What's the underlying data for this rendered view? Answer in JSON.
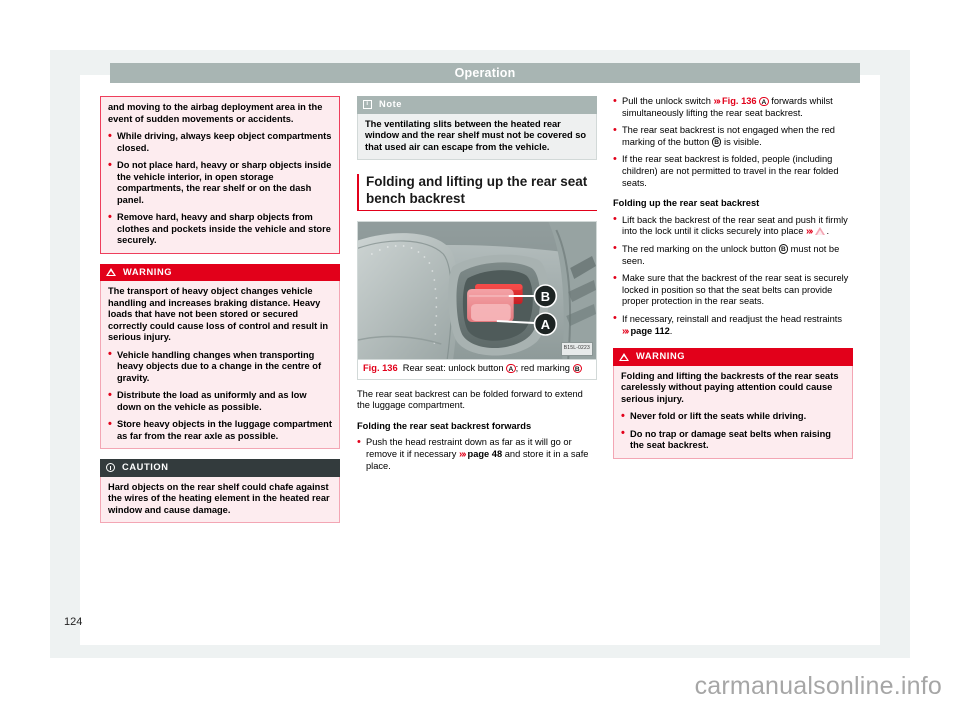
{
  "header": {
    "title": "Operation"
  },
  "footer": {
    "page_number": "124",
    "watermark": "carmanualsonline.info"
  },
  "column1": {
    "box_warning_continued": {
      "intro": "and moving to the airbag deployment area in the event of sudden movements or accidents.",
      "bullets": [
        "While driving, always keep object compartments closed.",
        "Do not place hard, heavy or sharp objects inside the vehicle interior, in open storage compartments, the rear shelf or on the dash panel.",
        "Remove hard, heavy and sharp objects from clothes and pockets inside the vehicle and store securely."
      ]
    },
    "box_warning": {
      "title": "WARNING",
      "icon": "warning-triangle-icon",
      "intro": "The transport of heavy object changes vehicle handling and increases braking distance. Heavy loads that have not been stored or secured correctly could cause loss of control and result in serious injury.",
      "bullets": [
        "Vehicle handling changes when transporting heavy objects due to a change in the centre of gravity.",
        "Distribute the load as uniformly and as low down on the vehicle as possible.",
        "Store heavy objects in the luggage compartment as far from the rear axle as possible."
      ]
    },
    "box_caution": {
      "title": "CAUTION",
      "icon": "exclamation-circle-icon",
      "text": "Hard objects on the rear shelf could chafe against the wires of the heating element in the heated rear window and cause damage."
    }
  },
  "column2": {
    "box_note": {
      "title": "Note",
      "icon": "info-icon",
      "text": "The ventilating slits between the heated rear window and the rear shelf must not be covered so that used air can escape from the vehicle."
    },
    "section_heading": "Folding and lifting up the rear seat bench backrest",
    "figure": {
      "number": "Fig. 136",
      "caption_part1": "Rear seat: unlock button ",
      "marker_a": "A",
      "caption_part2": "; red marking ",
      "marker_b": "B",
      "image_code": "B15L-0223",
      "callout_a": "A",
      "callout_b": "B"
    },
    "intro": "The rear seat backrest can be folded forward to extend the luggage compartment.",
    "sub_heading": "Folding the rear seat backrest forwards",
    "bullet1_part1": "Push the head restraint down as far as it will go or remove it if necessary ",
    "bullet1_ref": "page 48",
    "bullet1_part2": " and store it in a safe place."
  },
  "column3": {
    "bullet1_part1": "Pull the unlock switch ",
    "bullet1_ref": "Fig. 136",
    "bullet1_marker": "A",
    "bullet1_part2": " forwards whilst simultaneously lifting the rear seat backrest.",
    "bullet2_part1": "The rear seat backrest is not engaged when the red marking of the button ",
    "bullet2_marker": "B",
    "bullet2_part2": " is visible.",
    "bullet3": "If the rear seat backrest is folded, people (including children) are not permitted to travel in the rear folded seats.",
    "sub_heading": "Folding up the rear seat backrest",
    "bullet4_part1": "Lift back the backrest of the rear seat and push it firmly into the lock until it clicks securely into place ",
    "bullet4_part2": ".",
    "bullet5_part1": "The red marking on the unlock button ",
    "bullet5_marker": "B",
    "bullet5_part2": " must not be seen.",
    "bullet6": "Make sure that the backrest of the rear seat is securely locked in position so that the seat belts can provide proper protection in the rear seats.",
    "bullet7_part1": "If necessary, reinstall and readjust the head restraints ",
    "bullet7_ref": "page 112",
    "bullet7_part2": ".",
    "box_warning": {
      "title": "WARNING",
      "icon": "warning-triangle-icon",
      "intro": "Folding and lifting the backrests of the rear seats carelessly without paying attention could cause serious injury.",
      "bullets": [
        "Never fold or lift the seats while driving.",
        "Do no trap or damage seat belts when raising the seat backrest."
      ]
    }
  },
  "colors": {
    "warning_red": "#e2001a",
    "header_grey": "#a8b5b3",
    "caution_dark": "#333b3d",
    "pink_bg": "#fdecef"
  }
}
